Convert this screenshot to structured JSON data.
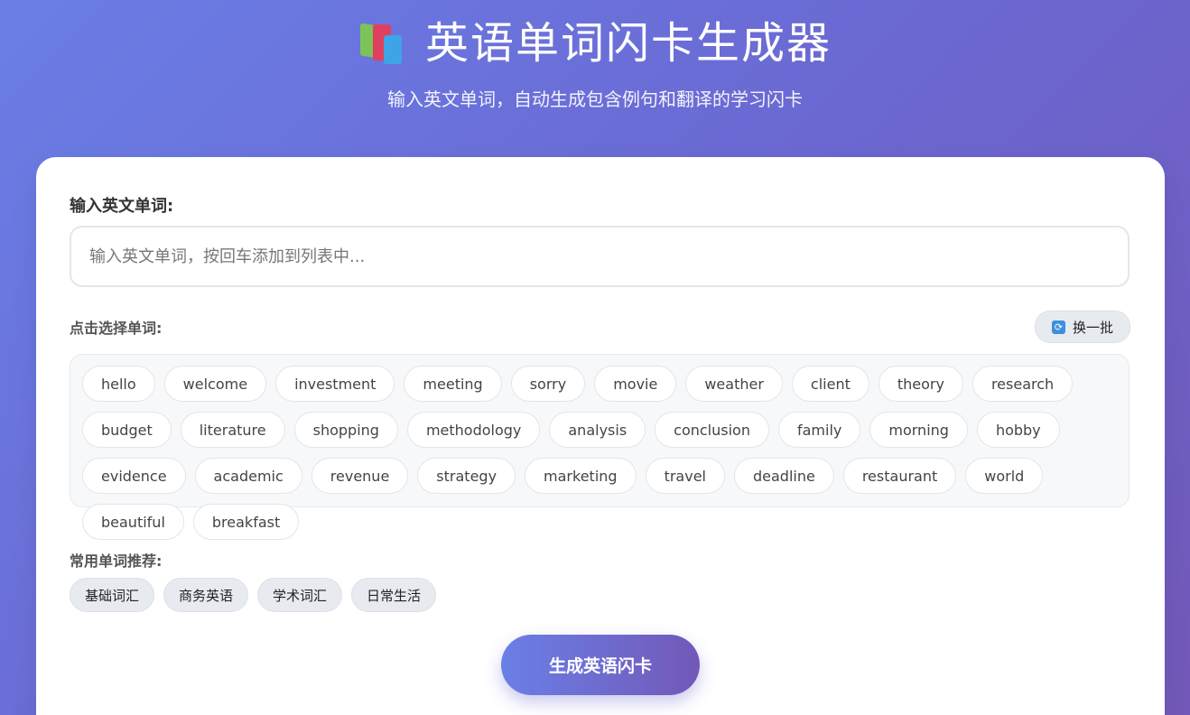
{
  "header": {
    "icon": "books-icon",
    "title": "英语单词闪卡生成器",
    "subtitle": "输入英文单词，自动生成包含例句和翻译的学习闪卡"
  },
  "form": {
    "input_label": "输入英文单词:",
    "input_placeholder": "输入英文单词，按回车添加到列表中...",
    "input_value": "",
    "select_label": "点击选择单词:",
    "refresh_icon": "refresh-icon",
    "refresh_label": "换一批",
    "words": [
      "hello",
      "welcome",
      "investment",
      "meeting",
      "sorry",
      "movie",
      "weather",
      "client",
      "theory",
      "research",
      "budget",
      "literature",
      "shopping",
      "methodology",
      "analysis",
      "conclusion",
      "family",
      "morning",
      "hobby",
      "evidence",
      "academic",
      "revenue",
      "strategy",
      "marketing",
      "travel",
      "deadline",
      "restaurant",
      "world",
      "beautiful",
      "breakfast"
    ],
    "recommend_label": "常用单词推荐:",
    "recommend_items": [
      "基础词汇",
      "商务英语",
      "学术词汇",
      "日常生活"
    ],
    "generate_label": "生成英语闪卡"
  },
  "colors": {
    "gradient_start": "#6a7fe6",
    "gradient_end": "#7258b8",
    "card_bg": "#ffffff"
  }
}
